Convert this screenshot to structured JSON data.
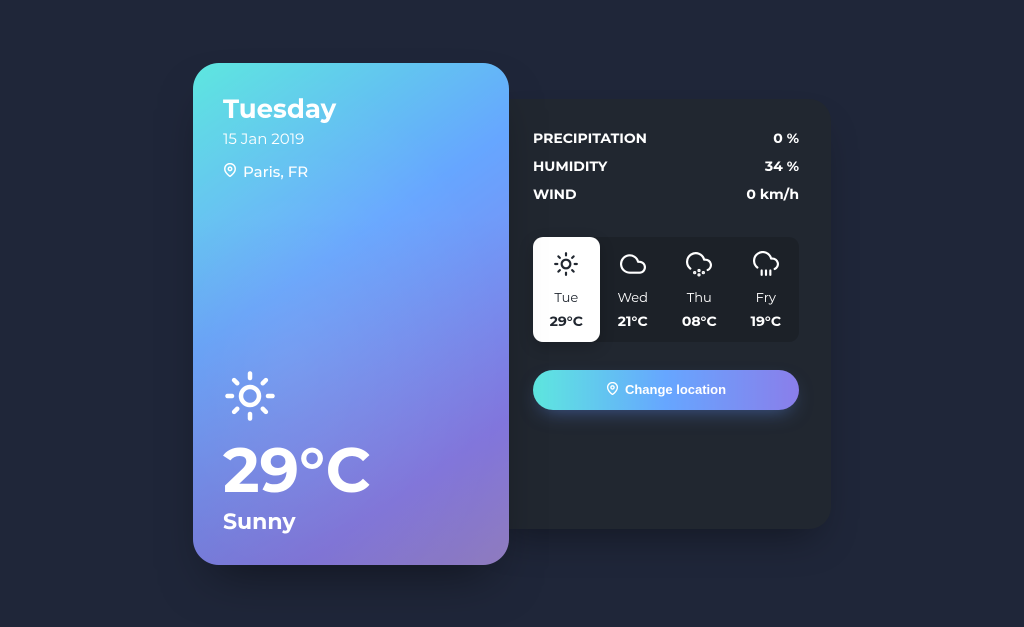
{
  "current": {
    "day": "Tuesday",
    "date": "15 Jan 2019",
    "location": "Paris, FR",
    "temp": "29°C",
    "condition": "Sunny"
  },
  "stats": {
    "precipitation": {
      "label": "Precipitation",
      "value": "0 %"
    },
    "humidity": {
      "label": "Humidity",
      "value": "34 %"
    },
    "wind": {
      "label": "Wind",
      "value": "0 km/h"
    }
  },
  "forecast": [
    {
      "day": "Tue",
      "temp": "29°C",
      "icon": "sun",
      "active": true
    },
    {
      "day": "Wed",
      "temp": "21°C",
      "icon": "cloud",
      "active": false
    },
    {
      "day": "Thu",
      "temp": "08°C",
      "icon": "snow",
      "active": false
    },
    {
      "day": "Fry",
      "temp": "19°C",
      "icon": "rain",
      "active": false
    }
  ],
  "actions": {
    "change_location": "Change location"
  }
}
